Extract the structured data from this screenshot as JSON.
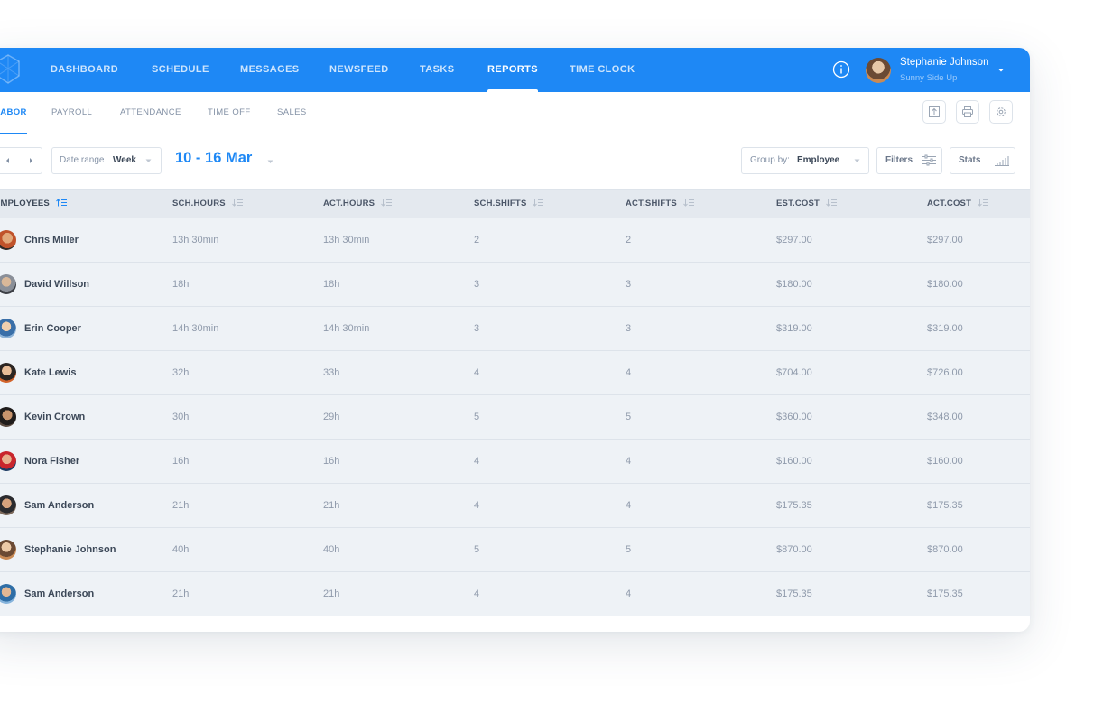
{
  "colors": {
    "primary": "#1e88f5",
    "header_bg": "#e4e9ef",
    "row_bg": "#eef2f6"
  },
  "topnav": {
    "items": [
      "DASHBOARD",
      "SCHEDULE",
      "MESSAGES",
      "NEWSFEED",
      "TASKS",
      "REPORTS",
      "TIME CLOCK"
    ],
    "active": "REPORTS",
    "user": {
      "name": "Stephanie Johnson",
      "company": "Sunny Side Up"
    },
    "icons": [
      "logo-icon",
      "info-icon",
      "chevron-down-icon"
    ]
  },
  "subnav": {
    "items": [
      "LABOR",
      "PAYROLL",
      "ATTENDANCE",
      "TIME OFF",
      "SALES"
    ],
    "active": "LABOR",
    "icons": [
      "export-icon",
      "print-icon",
      "gear-icon"
    ]
  },
  "toolbar": {
    "date_range_label": "Date range",
    "date_range_value": "Week",
    "date_title": "10 - 16 Mar",
    "group_by_label": "Group by:",
    "group_by_value": "Employee",
    "filters_label": "Filters",
    "stats_label": "Stats"
  },
  "table": {
    "columns": [
      "EMPLOYEES",
      "SCH.HOURS",
      "ACT.HOURS",
      "SCH.SHIFTS",
      "ACT.SHIFTS",
      "EST.COST",
      "ACT.COST"
    ],
    "rows": [
      {
        "name": "Chris Miller",
        "sch_hours": "13h 30min",
        "act_hours": "13h 30min",
        "sch_shifts": "2",
        "act_shifts": "2",
        "est_cost": "$297.00",
        "act_cost": "$297.00"
      },
      {
        "name": "David Willson",
        "sch_hours": "18h",
        "act_hours": "18h",
        "sch_shifts": "3",
        "act_shifts": "3",
        "est_cost": "$180.00",
        "act_cost": "$180.00"
      },
      {
        "name": "Erin Cooper",
        "sch_hours": "14h 30min",
        "act_hours": "14h 30min",
        "sch_shifts": "3",
        "act_shifts": "3",
        "est_cost": "$319.00",
        "act_cost": "$319.00"
      },
      {
        "name": "Kate Lewis",
        "sch_hours": "32h",
        "act_hours": "33h",
        "sch_shifts": "4",
        "act_shifts": "4",
        "est_cost": "$704.00",
        "act_cost": "$726.00"
      },
      {
        "name": "Kevin Crown",
        "sch_hours": "30h",
        "act_hours": "29h",
        "sch_shifts": "5",
        "act_shifts": "5",
        "est_cost": "$360.00",
        "act_cost": "$348.00"
      },
      {
        "name": "Nora Fisher",
        "sch_hours": "16h",
        "act_hours": "16h",
        "sch_shifts": "4",
        "act_shifts": "4",
        "est_cost": "$160.00",
        "act_cost": "$160.00"
      },
      {
        "name": "Sam Anderson",
        "sch_hours": "21h",
        "act_hours": "21h",
        "sch_shifts": "4",
        "act_shifts": "4",
        "est_cost": "$175.35",
        "act_cost": "$175.35"
      },
      {
        "name": "Stephanie Johnson",
        "sch_hours": "40h",
        "act_hours": "40h",
        "sch_shifts": "5",
        "act_shifts": "5",
        "est_cost": "$870.00",
        "act_cost": "$870.00"
      },
      {
        "name": "Sam Anderson",
        "sch_hours": "21h",
        "act_hours": "21h",
        "sch_shifts": "4",
        "act_shifts": "4",
        "est_cost": "$175.35",
        "act_cost": "$175.35"
      }
    ]
  }
}
